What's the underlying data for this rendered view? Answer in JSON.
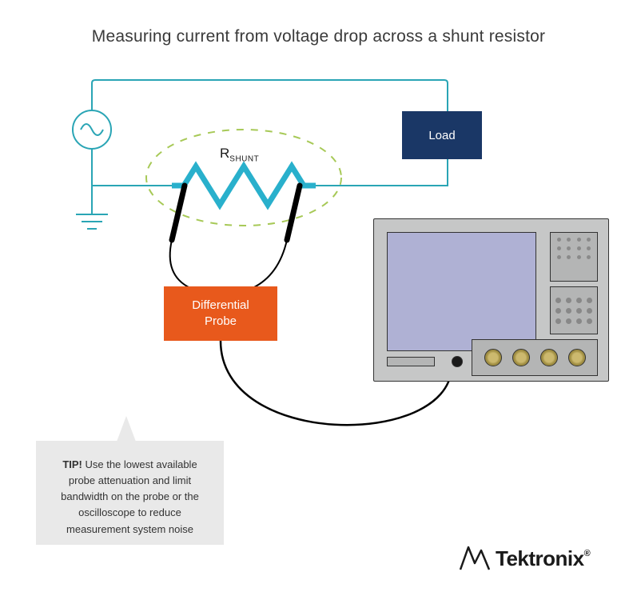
{
  "title": "Measuring current from voltage drop across a shunt resistor",
  "labels": {
    "load": "Load",
    "rshunt_main": "R",
    "rshunt_sub": "SHUNT",
    "probe": "Differential\nProbe"
  },
  "tip": {
    "prefix": "TIP!",
    "body": " Use the lowest available probe attenuation and limit bandwidth on the probe or the oscilloscope to reduce measurement system noise"
  },
  "brand": {
    "name": "Tektronix",
    "reg": "®"
  },
  "colors": {
    "wire": "#2aa5b5",
    "shunt": "#29b0cc",
    "dashed": "#a7c957",
    "load_bg": "#1a3766",
    "probe_bg": "#e8591c",
    "scope_body": "#c6c7c7",
    "scope_screen": "#afb1d4"
  }
}
